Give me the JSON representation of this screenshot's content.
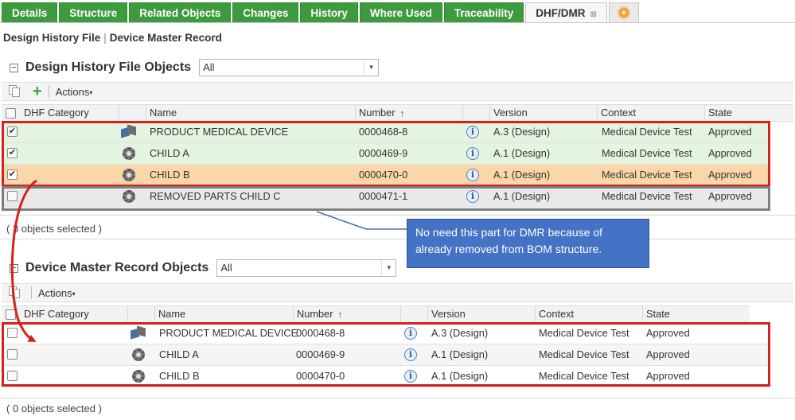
{
  "tabs": [
    {
      "label": "Details"
    },
    {
      "label": "Structure"
    },
    {
      "label": "Related Objects"
    },
    {
      "label": "Changes"
    },
    {
      "label": "History"
    },
    {
      "label": "Where Used"
    },
    {
      "label": "Traceability"
    },
    {
      "label": "DHF/DMR",
      "close": "⊠"
    }
  ],
  "breadcrumb": {
    "item1": "Design History File",
    "sep": "|",
    "item2": "Device Master Record"
  },
  "toolbar": {
    "actions_label": "Actions"
  },
  "dhf": {
    "title": "Design History File Objects",
    "filter_value": "All",
    "columns": [
      "DHF Category",
      "Name",
      "Number",
      "Version",
      "Context",
      "State"
    ],
    "sort_indicator": "↑",
    "rows": [
      {
        "name": "PRODUCT MEDICAL DEVICE",
        "number": "0000468-8",
        "version": "A.3 (Design)",
        "context": "Medical Device Test",
        "state": "Approved",
        "checked": "✔",
        "icon": "assembly-icon"
      },
      {
        "name": "CHILD A",
        "number": "0000469-9",
        "version": "A.1 (Design)",
        "context": "Medical Device Test",
        "state": "Approved",
        "checked": "✔",
        "icon": "gear-icon"
      },
      {
        "name": "CHILD B",
        "number": "0000470-0",
        "version": "A.1 (Design)",
        "context": "Medical Device Test",
        "state": "Approved",
        "checked": "✔",
        "icon": "gear-icon"
      },
      {
        "name": "REMOVED PARTS CHILD C",
        "number": "0000471-1",
        "version": "A.1 (Design)",
        "context": "Medical Device Test",
        "state": "Approved",
        "checked": "",
        "icon": "gear-icon"
      }
    ],
    "status": "( 3 objects selected )"
  },
  "dmr": {
    "title": "Device Master Record Objects",
    "filter_value": "All",
    "columns": [
      "DHF Category",
      "Name",
      "Number",
      "Version",
      "Context",
      "State"
    ],
    "sort_indicator": "↑",
    "rows": [
      {
        "name": "PRODUCT MEDICAL DEVICE",
        "number": "0000468-8",
        "version": "A.3 (Design)",
        "context": "Medical Device Test",
        "state": "Approved",
        "checked": "",
        "icon": "assembly-icon"
      },
      {
        "name": "CHILD A",
        "number": "0000469-9",
        "version": "A.1 (Design)",
        "context": "Medical Device Test",
        "state": "Approved",
        "checked": "",
        "icon": "gear-icon"
      },
      {
        "name": "CHILD B",
        "number": "0000470-0",
        "version": "A.1 (Design)",
        "context": "Medical Device Test",
        "state": "Approved",
        "checked": "",
        "icon": "gear-icon"
      }
    ],
    "status": "( 0 objects selected )"
  },
  "annotation": {
    "callout_text": "No need this part for DMR because of already removed from BOM structure.",
    "callout_color": "#4472c4",
    "highlight_color": "#d52020"
  },
  "colors": {
    "tab_green": "#3d9b3d",
    "row_selected": "#e4f5df",
    "row_highlight": "#f9d7a8",
    "row_removed": "#e9e9e9",
    "link": "#1d5f9e"
  },
  "icons": {
    "info": "i",
    "collapse": "−",
    "plus": "+",
    "caret": "▾",
    "dropdown": "▼"
  }
}
